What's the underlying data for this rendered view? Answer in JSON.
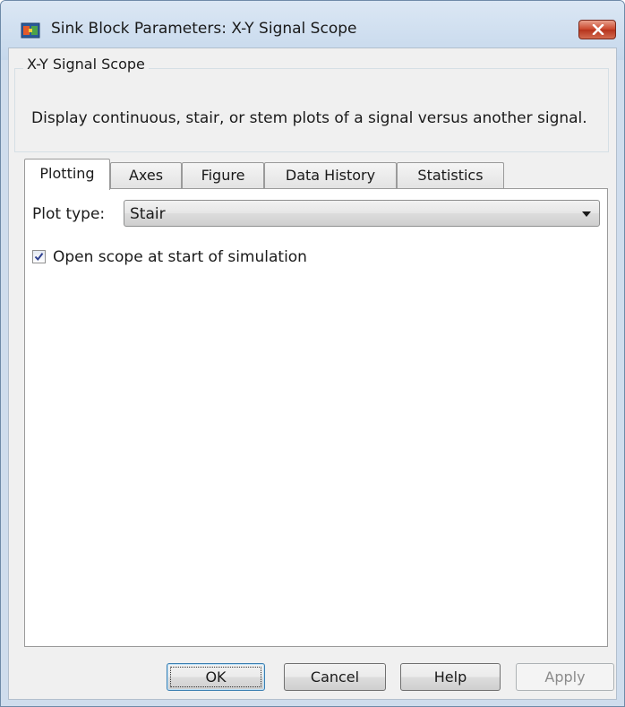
{
  "window": {
    "title": "Sink Block Parameters: X-Y Signal Scope"
  },
  "group": {
    "title": "X-Y Signal Scope",
    "description": "Display continuous, stair, or stem plots of a signal versus another signal."
  },
  "tabs": [
    {
      "label": "Plotting",
      "active": true
    },
    {
      "label": "Axes",
      "active": false
    },
    {
      "label": "Figure",
      "active": false
    },
    {
      "label": "Data History",
      "active": false
    },
    {
      "label": "Statistics",
      "active": false
    }
  ],
  "plotting": {
    "plot_type_label": "Plot type:",
    "plot_type_value": "Stair",
    "open_scope_label": "Open scope at start of simulation",
    "open_scope_checked": true
  },
  "buttons": {
    "ok": "OK",
    "cancel": "Cancel",
    "help": "Help",
    "apply": "Apply"
  },
  "colors": {
    "title_bar": "#c6d8ec",
    "close_button": "#c9452a",
    "dialog_background": "#f0f0f0",
    "panel_background": "#ffffff",
    "checkmark": "#2e3f8f"
  },
  "icons": {
    "app": "simulink-block-icon",
    "close": "close-icon",
    "dropdown": "chevron-down-icon",
    "check": "checkmark-icon"
  }
}
